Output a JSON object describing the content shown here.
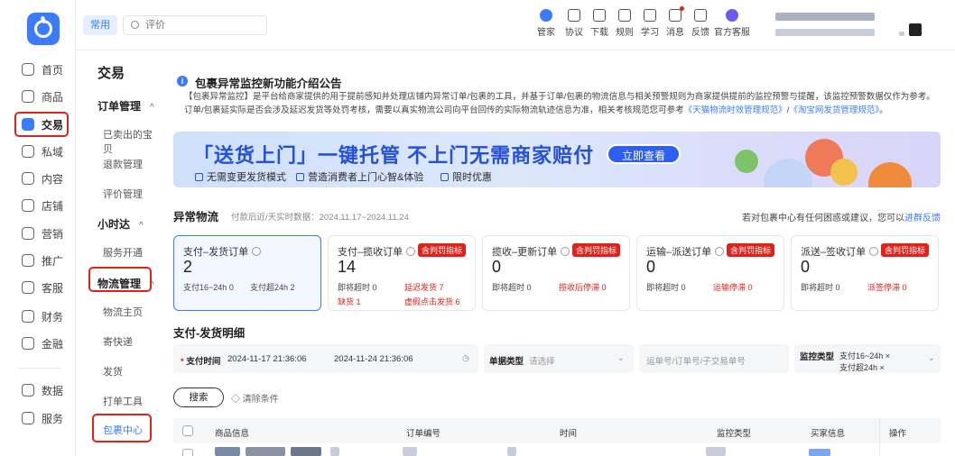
{
  "rail": {
    "items": [
      {
        "label": "首页",
        "icon": "home-icon"
      },
      {
        "label": "商品",
        "icon": "goods-icon"
      },
      {
        "label": "交易",
        "icon": "trade-icon",
        "active": true
      },
      {
        "label": "私域",
        "icon": "private-icon"
      },
      {
        "label": "内容",
        "icon": "content-icon"
      },
      {
        "label": "店铺",
        "icon": "shop-icon"
      },
      {
        "label": "营销",
        "icon": "marketing-icon"
      },
      {
        "label": "推广",
        "icon": "promotion-icon"
      },
      {
        "label": "客服",
        "icon": "service-icon"
      },
      {
        "label": "财务",
        "icon": "finance-icon"
      },
      {
        "label": "金融",
        "icon": "loan-icon"
      },
      {
        "label": "数据",
        "icon": "data-icon"
      },
      {
        "label": "服务",
        "icon": "services-icon"
      }
    ]
  },
  "subnav": {
    "title": "交易",
    "groups": [
      {
        "label": "订单管理",
        "caret": "^"
      },
      {
        "label": "小时达",
        "caret": "^"
      },
      {
        "label": "物流管理",
        "caret": "^"
      }
    ],
    "items": [
      "已卖出的宝贝",
      "退款管理",
      "评价管理",
      "服务开通",
      "物流主页",
      "寄快递",
      "发货",
      "打单工具",
      "包裹中心"
    ]
  },
  "topbar": {
    "chip": "常用",
    "search_placeholder": "评价",
    "tools": [
      {
        "label": "管家",
        "icon": "butler-icon"
      },
      {
        "label": "协议",
        "icon": "agreement-icon"
      },
      {
        "label": "下载",
        "icon": "download-icon"
      },
      {
        "label": "规则",
        "icon": "rules-icon"
      },
      {
        "label": "学习",
        "icon": "learn-icon"
      },
      {
        "label": "消息",
        "icon": "message-icon"
      },
      {
        "label": "反馈",
        "icon": "feedback-icon"
      },
      {
        "label": "官方客服",
        "icon": "official-service-icon"
      }
    ]
  },
  "notice": {
    "title": "包裹异常监控新功能介绍公告",
    "body": "【包裹异常监控】是平台给商家提供的用于提前感知并处理店铺内异常订单/包裹的工具，并基于订单/包裹的物流信息与相关预警规则为商家提供提前的监控预警与提醒，该监控预警数据仅作为参考。订单/包裹延实际是否会涉及延迟发货等处罚考核，需要以真实物流公司向平台回传的实际物流轨迹信息为准，相关考核规范您可参考",
    "link1": "《天猫物流时效管理规范》",
    "sep": "/",
    "link2": "《淘宝网发货管理规范》",
    "end": "。"
  },
  "banner": {
    "title": "「送货上门」一键托管 不上门无需商家赔付",
    "button": "立即查看",
    "features": [
      "无需变更发货模式",
      "营造消费者上门心智&体验",
      "限时优惠"
    ]
  },
  "abnormal": {
    "title": "异常物流",
    "subtitle": "付款后近/天实时数据：2024.11.17~2024.11.24",
    "feedback_text": "若对包裹中心有任何困惑或建议，您可以",
    "feedback_link": "进群反馈",
    "cards": [
      {
        "title": "支付–发货订单",
        "count": "2",
        "selected": true,
        "metrics": [
          {
            "label": "支付16~24h",
            "value": "0"
          },
          {
            "label": "支付超24h",
            "value": "2"
          }
        ]
      },
      {
        "title": "支付–揽收订单",
        "count": "14",
        "badge": "含判罚指标",
        "metrics": [
          {
            "label": "即将超时",
            "value": "0"
          },
          {
            "label": "延迟发货",
            "value": "7",
            "red": true
          },
          {
            "label": "缺货",
            "value": "1",
            "red": true
          },
          {
            "label": "虚假点击发货",
            "value": "6",
            "red": true
          }
        ]
      },
      {
        "title": "揽收–更新订单",
        "count": "0",
        "badge": "含判罚指标",
        "metrics": [
          {
            "label": "即将超时",
            "value": "0"
          },
          {
            "label": "揽收后停滞",
            "value": "0",
            "red": true
          }
        ]
      },
      {
        "title": "运输–派送订单",
        "count": "0",
        "badge": "含判罚指标",
        "metrics": [
          {
            "label": "即将超时",
            "value": "0"
          },
          {
            "label": "运输停滞",
            "value": "0",
            "red": true
          }
        ]
      },
      {
        "title": "派送–签收订单",
        "count": "0",
        "badge": "含判罚指标",
        "metrics": [
          {
            "label": "即将超时",
            "value": "0"
          },
          {
            "label": "派签停滞",
            "value": "0",
            "red": true
          }
        ]
      }
    ]
  },
  "detail": {
    "title": "支付-发货明细",
    "pay_time_label": "支付时间",
    "pay_time_start": "2024-11-17 21:36:06",
    "pay_time_end": "2024-11-24 21:36:06",
    "doc_type_label": "单据类型",
    "doc_type_placeholder": "请选择",
    "order_no_placeholder": "运单号/订单号/子交易单号",
    "monitor_label": "监控类型",
    "monitor_tags": [
      "支付16~24h ×",
      "支付超24h ×"
    ],
    "search_button": "搜索",
    "clear_link": "清除条件",
    "columns": [
      "商品信息",
      "订单编号",
      "时间",
      "监控类型",
      "买家信息",
      "操作"
    ]
  },
  "colors": {
    "accent": "#3a7cfb",
    "highlight": "#e0221b"
  }
}
